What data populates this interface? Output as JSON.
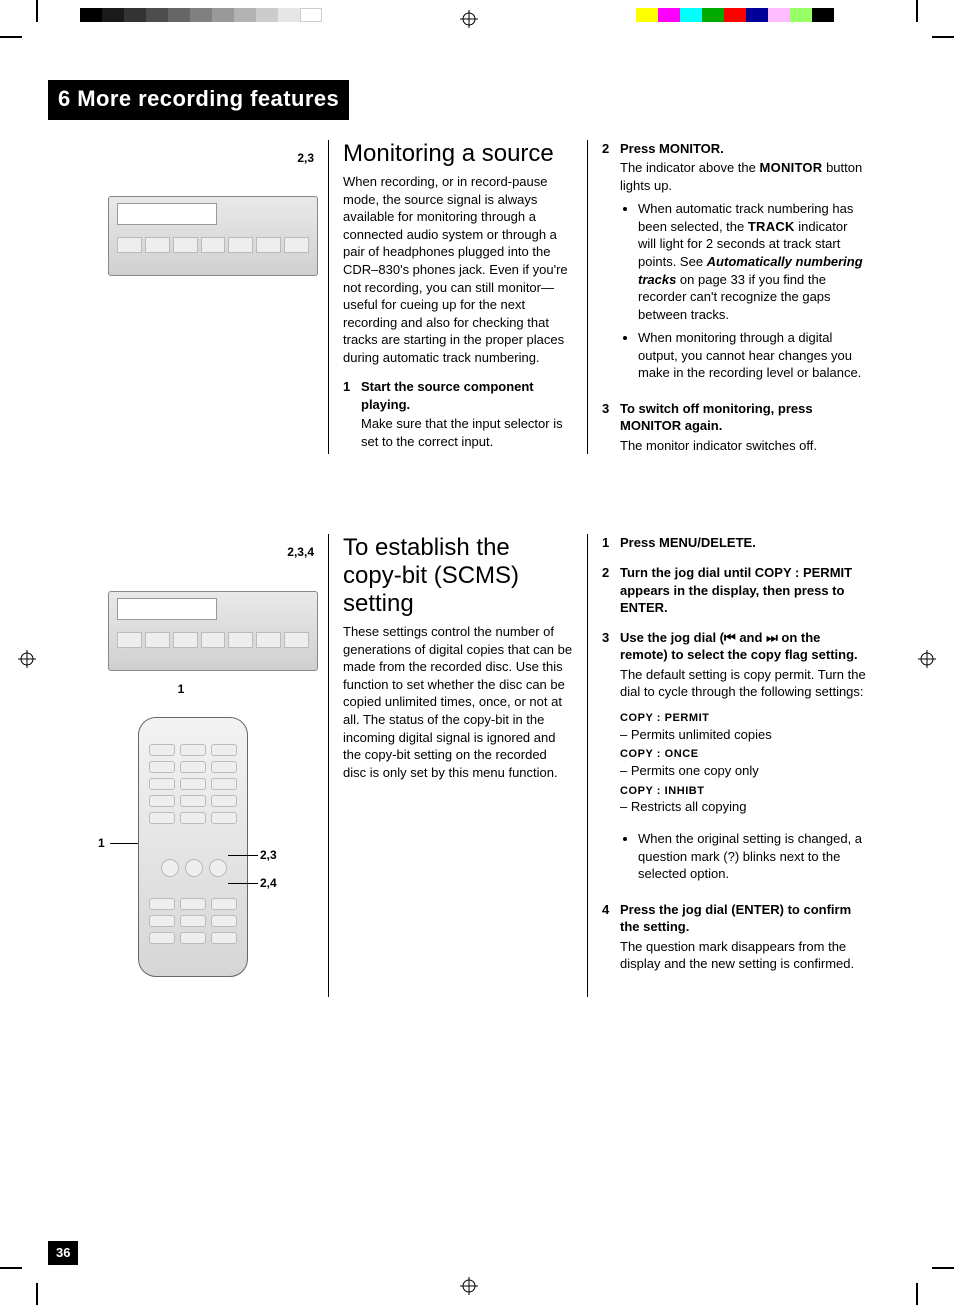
{
  "section_tab": "6 More recording features",
  "page_number": "36",
  "fig1": {
    "callout_top": "2,3"
  },
  "fig2": {
    "callout_top": "2,3,4",
    "callout_bottom": "1"
  },
  "remote": {
    "l1": "1",
    "r1": "2,3",
    "r2": "2,4"
  },
  "topic1": {
    "heading": "Monitoring a source",
    "intro": "When recording, or in record-pause mode, the source signal is always available for monitoring through a connected audio system or through a pair of headphones plugged into the CDR–830's phones jack. Even if you're not recording, you can still monitor—useful for cueing up for the next recording and also for checking that tracks are starting in the proper places during automatic track numbering.",
    "step1_num": "1",
    "step1_lead": "Start the source component playing.",
    "step1_body": "Make sure that the input selector is set to the correct input.",
    "step2_num": "2",
    "step2_lead": "Press MONITOR.",
    "step2_body_a": "The indicator above the ",
    "step2_body_sc": "MONITOR",
    "step2_body_b": " button lights up.",
    "step2_bullet1_a": "When automatic track numbering has been selected, the ",
    "step2_bullet1_sc": "TRACK",
    "step2_bullet1_b": " indicator will light for 2 seconds at track start points. See ",
    "step2_bullet1_em": "Automatically numbering tracks",
    "step2_bullet1_c": " on page 33 if you find the recorder can't recognize the gaps between tracks.",
    "step2_bullet2": "When monitoring through a digital output, you cannot hear changes you make in the recording level or balance.",
    "step3_num": "3",
    "step3_lead": "To switch off monitoring, press MONITOR again.",
    "step3_body": "The monitor indicator switches off."
  },
  "topic2": {
    "heading": "To establish the copy-bit (SCMS) setting",
    "intro": "These settings control the number of generations of digital copies that can be made from the recorded disc. Use this function to set whether the disc can be copied unlimited times, once, or not at all. The status of the copy-bit in the incoming digital signal is ignored and the copy-bit setting on the recorded disc is only set by this menu function.",
    "step1_num": "1",
    "step1_lead": "Press MENU/DELETE.",
    "step2_num": "2",
    "step2_lead": "Turn the jog dial until COPY : PERMIT appears in the display, then press to ENTER.",
    "step3_num": "3",
    "step3_lead_a": "Use the jog dial (",
    "step3_lead_b": " and ",
    "step3_lead_c": " on the remote) to select the copy flag setting.",
    "step3_body": "The default setting is copy permit. Turn the dial to cycle through the following settings:",
    "opt1_label": "COPY : PERMIT",
    "opt1_desc": "– Permits unlimited copies",
    "opt2_label": "COPY : ONCE",
    "opt2_desc": "– Permits one copy only",
    "opt3_label": "COPY : INHIBT",
    "opt3_desc": "– Restricts all copying",
    "step3_bullet": "When the original setting is changed, a question mark (?) blinks next to the selected option.",
    "step4_num": "4",
    "step4_lead": "Press the jog dial (ENTER) to confirm the setting.",
    "step4_body": "The question mark disappears from the display and the new setting is confirmed."
  }
}
